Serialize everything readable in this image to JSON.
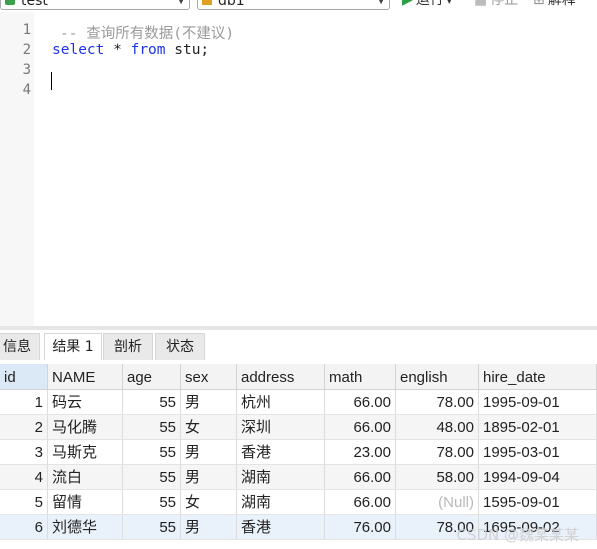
{
  "toolbar": {
    "connection": "test",
    "database": "db1",
    "run_label": "运行",
    "stop_label": "停止",
    "explain_label": "解释"
  },
  "editor": {
    "line_numbers": [
      "1",
      "2",
      "3",
      "4"
    ],
    "comment": "-- 查询所有数据(不建议)",
    "sql_select": "select",
    "sql_star": " * ",
    "sql_from": "from",
    "sql_rest": " stu;"
  },
  "tabs": [
    "信息",
    "结果 1",
    "剖析",
    "状态"
  ],
  "active_tab": "结果 1",
  "result": {
    "columns": [
      "id",
      "NAME",
      "age",
      "sex",
      "address",
      "math",
      "english",
      "hire_date"
    ],
    "rows": [
      [
        "1",
        "码云",
        "55",
        "男",
        "杭州",
        "66.00",
        "78.00",
        "1995-09-01"
      ],
      [
        "2",
        "马化腾",
        "55",
        "女",
        "深圳",
        "66.00",
        "48.00",
        "1895-02-01"
      ],
      [
        "3",
        "马斯克",
        "55",
        "男",
        "香港",
        "23.00",
        "78.00",
        "1995-03-01"
      ],
      [
        "4",
        "流白",
        "55",
        "男",
        "湖南",
        "66.00",
        "58.00",
        "1994-09-04"
      ],
      [
        "5",
        "留情",
        "55",
        "女",
        "湖南",
        "66.00",
        "(Null)",
        "1595-09-01"
      ],
      [
        "6",
        "刘德华",
        "55",
        "男",
        "香港",
        "76.00",
        "78.00",
        "1695-09-02"
      ]
    ]
  },
  "watermark": "CSDN @魏某某某"
}
